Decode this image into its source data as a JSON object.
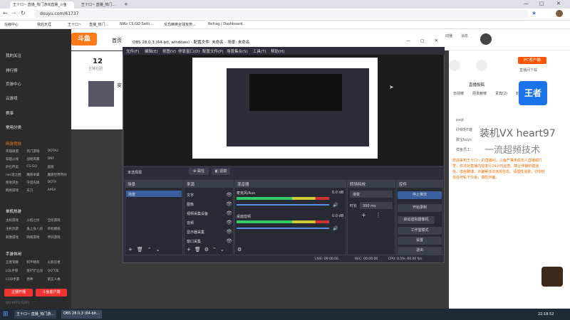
{
  "browser": {
    "tabs": [
      {
        "label": "王十口~ 直播_热门游戏直播_斗鱼"
      },
      {
        "label": "王十口~ 直播_热门..."
      }
    ],
    "url": "douyu.com/61737",
    "bookmarks": [
      "在線中心",
      "我的天涯",
      "王十口~",
      "直播_热门...",
      "NiKo CS:GO Setti...",
      "反恐精英全球攻势...",
      "Refrag | Dashboard"
    ]
  },
  "site": {
    "logo": "斗鱼",
    "nav_home": "首页",
    "right_icons": [
      "动播",
      "消息",
      "发布",
      "历史",
      "我的"
    ],
    "follow_count": "12",
    "follow_label": "主播社团",
    "avatar_label": "安",
    "side_labels": [
      "动物吃瓜",
      "我的",
      ""
    ]
  },
  "sidebar": {
    "items": [
      "我的关注",
      "排行榜",
      "页游中心",
      "云游戏",
      "赛事"
    ],
    "section_common": "常用分类",
    "section_hot": "网游竞技",
    "hot_tags": [
      [
        "英雄联盟",
        "热门游戏",
        "DOTA2"
      ],
      [
        "穿越火线",
        "战地风暴",
        "DNF"
      ],
      [
        "炉石传说",
        "CS:GO",
        "逃跑"
      ],
      [
        "nec迷之胜",
        "魔兽争霸",
        "魔兽世界怀旧"
      ],
      [
        "绝地求生",
        "守望先锋",
        "DOTA"
      ],
      [
        "网易游戏",
        "天刀",
        "APEX"
      ]
    ],
    "section_mobile": "单机热游",
    "mobile_tags": [
      [
        "主机游戏",
        "火焰之纹",
        "全民游戏"
      ],
      [
        "主机热游",
        "鬼上身八块",
        "单机模拟"
      ],
      [
        "刺激游戏",
        "网络游戏",
        "怀旧游戏"
      ]
    ],
    "section_hand": "手游休闲",
    "hand_tags": [
      [
        "王者荣耀",
        "和平精英",
        "火影忍者"
      ],
      [
        "LOL手游",
        "金铲铲之战",
        "QQ飞车"
      ],
      [
        "COD手游",
        "原神",
        "第五人格"
      ]
    ],
    "btn_open": "主播开播",
    "btn_download": "斗鱼客户端",
    "footer": "QQ:9ATQ  6201"
  },
  "obs": {
    "title": "OBS 28.0.3 (64-bit, windows) - 配置文件: 未命名 - 场景: 未命名",
    "menu": [
      "文件(F)",
      "编辑(E)",
      "视图(V)",
      "停靠窗口(D)",
      "配置文件(P)",
      "场景集合(S)",
      "工具(T)",
      "帮助(H)"
    ],
    "no_source": "未选择源",
    "btn_properties": "属性",
    "btn_filters": "滤镜",
    "docks": {
      "scenes": "场景",
      "sources": "来源",
      "mixer": "混音器",
      "transitions": "转场特效",
      "controls": "控件"
    },
    "scene_items": [
      "场景"
    ],
    "source_items": [
      "文字",
      "图像",
      "视频采集设备",
      "音频",
      "显示器采集",
      "窗口采集"
    ],
    "mixer": [
      {
        "name": "麦克风/Aux",
        "level": "0.0 dB"
      },
      {
        "name": "桌面音频",
        "level": "0.0 dB"
      }
    ],
    "transition": {
      "type": "渐变",
      "duration_label": "时长",
      "duration": "300 ms"
    },
    "controls": [
      "停止推流",
      "开始录制",
      "启动虚拟摄像机",
      "工作室模式",
      "设置",
      "退出"
    ],
    "status": {
      "live": "LIVE: 00:00:00",
      "rec": "REC: 00:00:00",
      "cpu": "CPU: 0.5%, 60.00 fps"
    }
  },
  "right": {
    "btn_pc": "PC客户端",
    "btn_live": "直播间下载",
    "rank_label": "直播投稿",
    "tabs": [
      "日前榜",
      "周贡献榜",
      "贵宾(2)",
      "粉丝团"
    ],
    "notice": "欢迎来到王十口~ 的直播间。斗鱼严禁未成年人直播或打赏，依法对直播内容进行24小时巡查。禁止传播封建迷信、低俗赌博、诈骗等违法违规信息。请理性消费，切勿轻信任何私下交易，谨防诈骗。",
    "watermark": [
      "装机VX  heart97",
      "一流超频技术"
    ],
    "chat_users": [
      "pxgt",
      "砂锅粉T雄",
      "脚宝boys",
      "摸鱼员工"
    ]
  },
  "taskbar": {
    "apps": [
      "王十口~ 直播_热门游...",
      "OBS 28.0.3 (64-bit..."
    ],
    "time": "22:18:52"
  }
}
